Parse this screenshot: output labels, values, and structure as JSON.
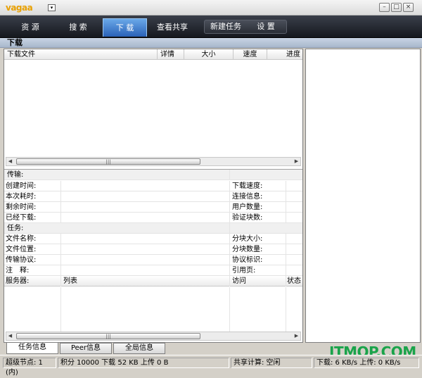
{
  "app": {
    "logo_text": "vagaa"
  },
  "nav": {
    "tabs": [
      {
        "label": "资 源"
      },
      {
        "label": "搜 索"
      },
      {
        "label": "下 载"
      },
      {
        "label": "查看共享"
      },
      {
        "label": "新建任务"
      },
      {
        "label": "设 置"
      }
    ]
  },
  "section_title": "下载",
  "download_table": {
    "columns": [
      "下载文件",
      "详情",
      "大小",
      "速度",
      "进度"
    ]
  },
  "details": {
    "transfer_header": "传输:",
    "rows_left_1": [
      "创建时间:",
      "本次耗时:",
      "剩余时间:",
      "已经下载:"
    ],
    "rows_right_1": [
      "下载速度:",
      "连接信息:",
      "用户数量:",
      "验证块数:"
    ],
    "task_header": "任务:",
    "rows_left_2": [
      "文件名称:",
      "文件位置:",
      "传输协议:",
      "注　释:"
    ],
    "rows_right_2": [
      "分块大小:",
      "分块数量:",
      "协议标识:",
      "引用页:"
    ],
    "server_columns": [
      "服务器:",
      "列表",
      "访问",
      "状态"
    ]
  },
  "bottom_tabs": [
    "任务信息",
    "Peer信息",
    "全局信息"
  ],
  "status": {
    "super_node": "超级节点: 1 (内)",
    "stats": "积分 10000 下载 52 KB 上传 0 B",
    "share": "共享计算: 空闲",
    "speed": "下载: 6 KB/s 上传: 0 KB/s"
  },
  "watermark": "ITMOP.COM",
  "colors": {
    "nav_bg": "#15181e",
    "active_tab": "#2a62b8",
    "watermark": "#1aa34a"
  }
}
